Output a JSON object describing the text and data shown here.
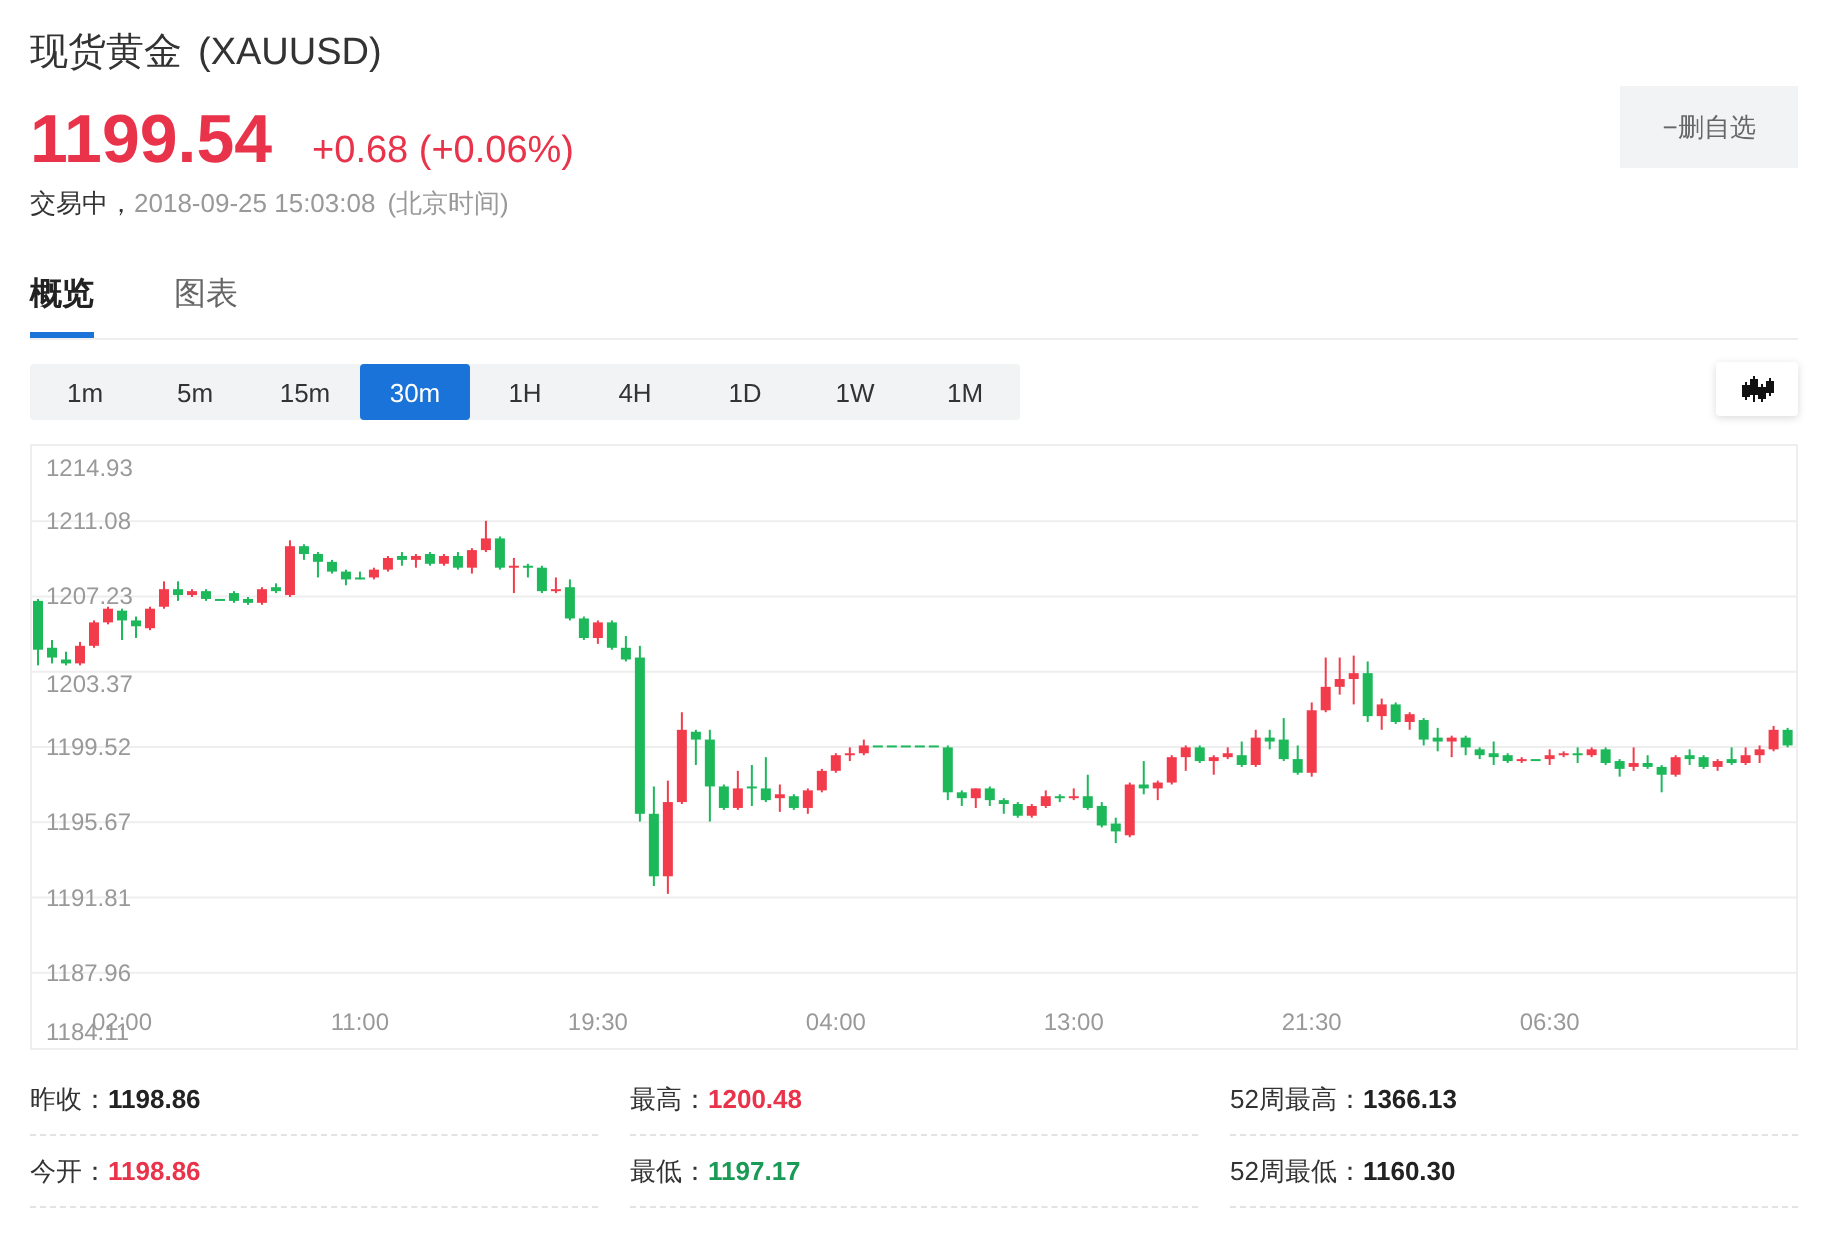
{
  "header": {
    "name": "现货黄金",
    "symbol": "(XAUUSD)",
    "price": "1199.54",
    "change": "+0.68 (+0.06%)",
    "status": "交易中，",
    "timestamp": "2018-09-25 15:03:08",
    "timezone": "(北京时间)",
    "watchlist_button": "−删自选"
  },
  "tabs": [
    {
      "label": "概览",
      "selected": true
    },
    {
      "label": "图表",
      "selected": false
    }
  ],
  "periods": [
    {
      "label": "1m",
      "selected": false
    },
    {
      "label": "5m",
      "selected": false
    },
    {
      "label": "15m",
      "selected": false
    },
    {
      "label": "30m",
      "selected": true
    },
    {
      "label": "1H",
      "selected": false
    },
    {
      "label": "4H",
      "selected": false
    },
    {
      "label": "1D",
      "selected": false
    },
    {
      "label": "1W",
      "selected": false
    },
    {
      "label": "1M",
      "selected": false
    }
  ],
  "chart": {
    "chart_data": {
      "type": "candlestick",
      "grid": true,
      "ylim": [
        1184.11,
        1214.93
      ],
      "yticks": [
        1214.93,
        1211.08,
        1207.23,
        1203.37,
        1199.52,
        1195.67,
        1191.81,
        1187.96,
        1184.11
      ],
      "categories": [
        null,
        null,
        null,
        null,
        null,
        null,
        "02:00",
        null,
        null,
        null,
        null,
        null,
        null,
        null,
        null,
        null,
        null,
        null,
        null,
        null,
        null,
        null,
        null,
        "11:00",
        null,
        null,
        null,
        null,
        null,
        null,
        null,
        null,
        null,
        null,
        null,
        null,
        null,
        null,
        null,
        null,
        "19:30",
        null,
        null,
        null,
        null,
        null,
        null,
        null,
        null,
        null,
        null,
        null,
        null,
        null,
        null,
        null,
        null,
        "04:00",
        null,
        null,
        null,
        null,
        null,
        null,
        null,
        null,
        null,
        null,
        null,
        null,
        null,
        null,
        null,
        null,
        "13:00",
        null,
        null,
        null,
        null,
        null,
        null,
        null,
        null,
        null,
        null,
        null,
        null,
        null,
        null,
        null,
        null,
        "21:30",
        null,
        null,
        null,
        null,
        null,
        null,
        null,
        null,
        null,
        null,
        null,
        null,
        null,
        null,
        null,
        null,
        "06:30",
        null,
        null,
        null,
        null,
        null,
        null,
        null,
        null,
        null,
        null,
        null,
        null,
        null,
        null,
        null,
        null,
        null
      ],
      "ohlc": [
        [
          1207.0,
          1207.1,
          1203.7,
          1204.5
        ],
        [
          1204.6,
          1205.0,
          1203.8,
          1204.1
        ],
        [
          1204.0,
          1204.4,
          1203.7,
          1203.8
        ],
        [
          1203.8,
          1204.9,
          1203.7,
          1204.7
        ],
        [
          1204.7,
          1206.0,
          1204.6,
          1205.9
        ],
        [
          1205.9,
          1206.7,
          1205.8,
          1206.6
        ],
        [
          1206.5,
          1206.6,
          1205.0,
          1206.0
        ],
        [
          1206.0,
          1206.2,
          1205.1,
          1205.7
        ],
        [
          1205.6,
          1206.7,
          1205.5,
          1206.6
        ],
        [
          1206.7,
          1208.0,
          1206.6,
          1207.6
        ],
        [
          1207.6,
          1208.0,
          1207.0,
          1207.3
        ],
        [
          1207.3,
          1207.6,
          1207.2,
          1207.5
        ],
        [
          1207.5,
          1207.6,
          1207.0,
          1207.1
        ],
        [
          1207.1,
          1207.1,
          1207.1,
          1207.1
        ],
        [
          1207.4,
          1207.5,
          1206.9,
          1207.0
        ],
        [
          1207.1,
          1207.2,
          1206.8,
          1206.9
        ],
        [
          1206.9,
          1207.7,
          1206.8,
          1207.6
        ],
        [
          1207.7,
          1207.9,
          1207.4,
          1207.5
        ],
        [
          1207.3,
          1210.1,
          1207.2,
          1209.8
        ],
        [
          1209.8,
          1209.9,
          1209.1,
          1209.4
        ],
        [
          1209.4,
          1209.5,
          1208.2,
          1209.0
        ],
        [
          1209.0,
          1209.1,
          1208.4,
          1208.5
        ],
        [
          1208.5,
          1208.6,
          1207.8,
          1208.1
        ],
        [
          1208.2,
          1208.5,
          1208.1,
          1208.1
        ],
        [
          1208.2,
          1208.7,
          1208.1,
          1208.6
        ],
        [
          1208.6,
          1209.3,
          1208.5,
          1209.2
        ],
        [
          1209.3,
          1209.5,
          1208.8,
          1209.1
        ],
        [
          1209.1,
          1209.4,
          1208.7,
          1209.3
        ],
        [
          1209.4,
          1209.5,
          1208.8,
          1208.9
        ],
        [
          1208.9,
          1209.4,
          1208.8,
          1209.3
        ],
        [
          1209.3,
          1209.5,
          1208.6,
          1208.7
        ],
        [
          1208.7,
          1209.7,
          1208.4,
          1209.6
        ],
        [
          1209.6,
          1211.1,
          1209.5,
          1210.2
        ],
        [
          1210.2,
          1210.3,
          1208.6,
          1208.7
        ],
        [
          1208.7,
          1209.2,
          1207.4,
          1208.8
        ],
        [
          1208.8,
          1208.9,
          1208.2,
          1208.7
        ],
        [
          1208.7,
          1208.8,
          1207.4,
          1207.5
        ],
        [
          1207.5,
          1208.2,
          1207.4,
          1207.6
        ],
        [
          1207.7,
          1208.1,
          1206.0,
          1206.1
        ],
        [
          1206.1,
          1206.2,
          1205.0,
          1205.1
        ],
        [
          1205.1,
          1206.0,
          1204.8,
          1205.9
        ],
        [
          1205.9,
          1206.0,
          1204.5,
          1204.6
        ],
        [
          1204.6,
          1205.2,
          1203.9,
          1204.0
        ],
        [
          1204.1,
          1204.7,
          1195.7,
          1196.1
        ],
        [
          1196.1,
          1197.5,
          1192.4,
          1192.9
        ],
        [
          1192.9,
          1197.8,
          1192.0,
          1196.7
        ],
        [
          1196.7,
          1201.3,
          1196.6,
          1200.4
        ],
        [
          1200.3,
          1200.4,
          1198.6,
          1199.9
        ],
        [
          1199.9,
          1200.4,
          1195.7,
          1197.5
        ],
        [
          1197.5,
          1197.6,
          1196.3,
          1196.4
        ],
        [
          1196.4,
          1198.3,
          1196.3,
          1197.4
        ],
        [
          1197.5,
          1198.6,
          1196.5,
          1197.4
        ],
        [
          1197.4,
          1199.0,
          1196.7,
          1196.8
        ],
        [
          1196.9,
          1197.6,
          1196.2,
          1197.1
        ],
        [
          1197.0,
          1197.1,
          1196.3,
          1196.4
        ],
        [
          1196.4,
          1197.4,
          1196.1,
          1197.3
        ],
        [
          1197.3,
          1198.4,
          1197.2,
          1198.3
        ],
        [
          1198.3,
          1199.2,
          1198.2,
          1199.1
        ],
        [
          1199.1,
          1199.5,
          1198.8,
          1199.2
        ],
        [
          1199.2,
          1199.9,
          1199.1,
          1199.6
        ],
        [
          1199.6,
          1199.6,
          1199.6,
          1199.6
        ],
        [
          1199.6,
          1199.6,
          1199.6,
          1199.6
        ],
        [
          1199.6,
          1199.6,
          1199.6,
          1199.6
        ],
        [
          1199.6,
          1199.6,
          1199.6,
          1199.6
        ],
        [
          1199.6,
          1199.6,
          1199.6,
          1199.6
        ],
        [
          1199.5,
          1199.6,
          1196.8,
          1197.2
        ],
        [
          1197.2,
          1197.3,
          1196.5,
          1196.9
        ],
        [
          1196.9,
          1197.4,
          1196.4,
          1197.4
        ],
        [
          1197.4,
          1197.5,
          1196.5,
          1196.8
        ],
        [
          1196.8,
          1196.9,
          1196.1,
          1196.6
        ],
        [
          1196.6,
          1196.7,
          1195.9,
          1196.0
        ],
        [
          1196.0,
          1196.6,
          1195.9,
          1196.5
        ],
        [
          1196.5,
          1197.3,
          1196.4,
          1197.0
        ],
        [
          1197.0,
          1197.1,
          1196.7,
          1196.9
        ],
        [
          1196.9,
          1197.4,
          1196.8,
          1197.0
        ],
        [
          1197.0,
          1198.1,
          1196.3,
          1196.4
        ],
        [
          1196.5,
          1196.7,
          1195.4,
          1195.5
        ],
        [
          1195.6,
          1195.9,
          1194.6,
          1195.2
        ],
        [
          1195.0,
          1197.7,
          1194.9,
          1197.6
        ],
        [
          1197.6,
          1198.8,
          1197.1,
          1197.4
        ],
        [
          1197.4,
          1197.8,
          1196.8,
          1197.7
        ],
        [
          1197.7,
          1199.1,
          1197.6,
          1199.0
        ],
        [
          1199.0,
          1199.6,
          1198.3,
          1199.5
        ],
        [
          1199.5,
          1199.6,
          1198.7,
          1198.8
        ],
        [
          1198.8,
          1199.1,
          1198.1,
          1199.0
        ],
        [
          1199.0,
          1199.5,
          1198.9,
          1199.2
        ],
        [
          1199.1,
          1199.8,
          1198.5,
          1198.6
        ],
        [
          1198.6,
          1200.4,
          1198.5,
          1200.0
        ],
        [
          1200.0,
          1200.4,
          1199.4,
          1199.8
        ],
        [
          1199.9,
          1201.0,
          1198.8,
          1198.9
        ],
        [
          1198.9,
          1199.6,
          1198.1,
          1198.2
        ],
        [
          1198.2,
          1201.8,
          1198.0,
          1201.4
        ],
        [
          1201.4,
          1204.1,
          1201.3,
          1202.6
        ],
        [
          1202.6,
          1204.1,
          1202.2,
          1203.0
        ],
        [
          1203.0,
          1204.2,
          1201.7,
          1203.3
        ],
        [
          1203.3,
          1203.9,
          1200.8,
          1201.1
        ],
        [
          1201.1,
          1202.0,
          1200.4,
          1201.7
        ],
        [
          1201.7,
          1201.8,
          1200.7,
          1200.8
        ],
        [
          1200.8,
          1201.3,
          1200.4,
          1201.2
        ],
        [
          1200.9,
          1201.0,
          1199.6,
          1199.9
        ],
        [
          1200.0,
          1200.5,
          1199.3,
          1199.8
        ],
        [
          1199.8,
          1200.1,
          1199.0,
          1200.0
        ],
        [
          1200.0,
          1200.1,
          1199.1,
          1199.5
        ],
        [
          1199.4,
          1199.5,
          1198.9,
          1199.1
        ],
        [
          1199.2,
          1199.8,
          1198.6,
          1199.0
        ],
        [
          1199.1,
          1199.2,
          1198.7,
          1198.8
        ],
        [
          1198.8,
          1199.0,
          1198.7,
          1198.9
        ],
        [
          1198.9,
          1198.9,
          1198.9,
          1198.9
        ],
        [
          1198.9,
          1199.4,
          1198.6,
          1199.1
        ],
        [
          1199.1,
          1199.3,
          1199.0,
          1199.2
        ],
        [
          1199.2,
          1199.5,
          1198.7,
          1199.1
        ],
        [
          1199.1,
          1199.5,
          1199.0,
          1199.4
        ],
        [
          1199.4,
          1199.5,
          1198.6,
          1198.7
        ],
        [
          1198.8,
          1198.9,
          1198.0,
          1198.4
        ],
        [
          1198.5,
          1199.5,
          1198.3,
          1198.7
        ],
        [
          1198.7,
          1199.1,
          1198.4,
          1198.5
        ],
        [
          1198.5,
          1198.6,
          1197.2,
          1198.1
        ],
        [
          1198.1,
          1199.1,
          1198.0,
          1199.0
        ],
        [
          1199.1,
          1199.4,
          1198.6,
          1198.9
        ],
        [
          1199.0,
          1199.1,
          1198.4,
          1198.5
        ],
        [
          1198.5,
          1198.9,
          1198.3,
          1198.8
        ],
        [
          1198.9,
          1199.5,
          1198.6,
          1198.7
        ],
        [
          1198.7,
          1199.5,
          1198.6,
          1199.1
        ],
        [
          1199.1,
          1199.6,
          1198.7,
          1199.4
        ],
        [
          1199.4,
          1200.6,
          1199.3,
          1200.4
        ],
        [
          1200.4,
          1200.5,
          1199.5,
          1199.6
        ]
      ]
    }
  },
  "stats": [
    {
      "label": "昨收：",
      "value": "1198.86",
      "color": "#222222"
    },
    {
      "label": "最高：",
      "value": "1200.48",
      "color": "#e8334a"
    },
    {
      "label": "52周最高：",
      "value": "1366.13",
      "color": "#222222"
    },
    {
      "label": "今开：",
      "value": "1198.86",
      "color": "#e8334a"
    },
    {
      "label": "最低：",
      "value": "1197.17",
      "color": "#1a9b55"
    },
    {
      "label": "52周最低：",
      "value": "1160.30",
      "color": "#222222"
    }
  ]
}
